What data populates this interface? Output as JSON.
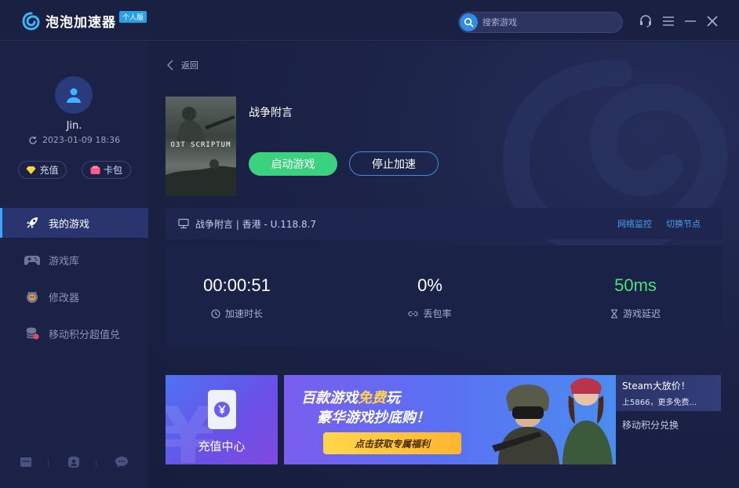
{
  "app": {
    "name": "泡泡加速器",
    "edition_badge": "个人版",
    "search_placeholder": "搜索游戏"
  },
  "sidebar": {
    "user": {
      "name": "Jin.",
      "expiry": "2023-01-09 18:36"
    },
    "pills": [
      {
        "label": "充值"
      },
      {
        "label": "卡包"
      }
    ],
    "nav": [
      {
        "label": "我的游戏",
        "icon": "rocket-icon",
        "active": true
      },
      {
        "label": "游戏库",
        "icon": "gamepad-icon",
        "active": false
      },
      {
        "label": "修改器",
        "icon": "tool-icon",
        "active": false
      },
      {
        "label": "移动积分超值兑",
        "icon": "coins-icon",
        "active": false
      }
    ]
  },
  "main": {
    "back_label": "返回",
    "game": {
      "title": "战争附言",
      "cover_text": "O3T SCRIPTUM",
      "start_label": "启动游戏",
      "stop_label": "停止加速"
    },
    "node": {
      "info": "战争附言 | 香港 - U.118.8.7",
      "monitor_label": "网络监控",
      "switch_label": "切换节点"
    },
    "stats": [
      {
        "value": "00:00:51",
        "label": "加速时长",
        "icon": "clock-icon"
      },
      {
        "value": "0%",
        "label": "丢包率",
        "icon": "link-icon"
      },
      {
        "value": "50ms",
        "label": "游戏延迟",
        "icon": "hourglass-icon"
      }
    ],
    "banners": {
      "recharge_label": "充值中心",
      "promo_line1_pre": "百款游戏",
      "promo_line1_hl": "免费",
      "promo_line1_post": "玩",
      "promo_line2": "豪华游戏抄底购！",
      "promo_button": "点击获取专属福利",
      "side_title": "Steam大放价！",
      "side_sub": "上5866，更多免费...",
      "side_link": "移动积分兑换"
    }
  },
  "colors": {
    "accent": "#36a6ff",
    "start_green": "#3ad27e",
    "latency_green": "#4be07a",
    "link_blue": "#4a9df2"
  }
}
